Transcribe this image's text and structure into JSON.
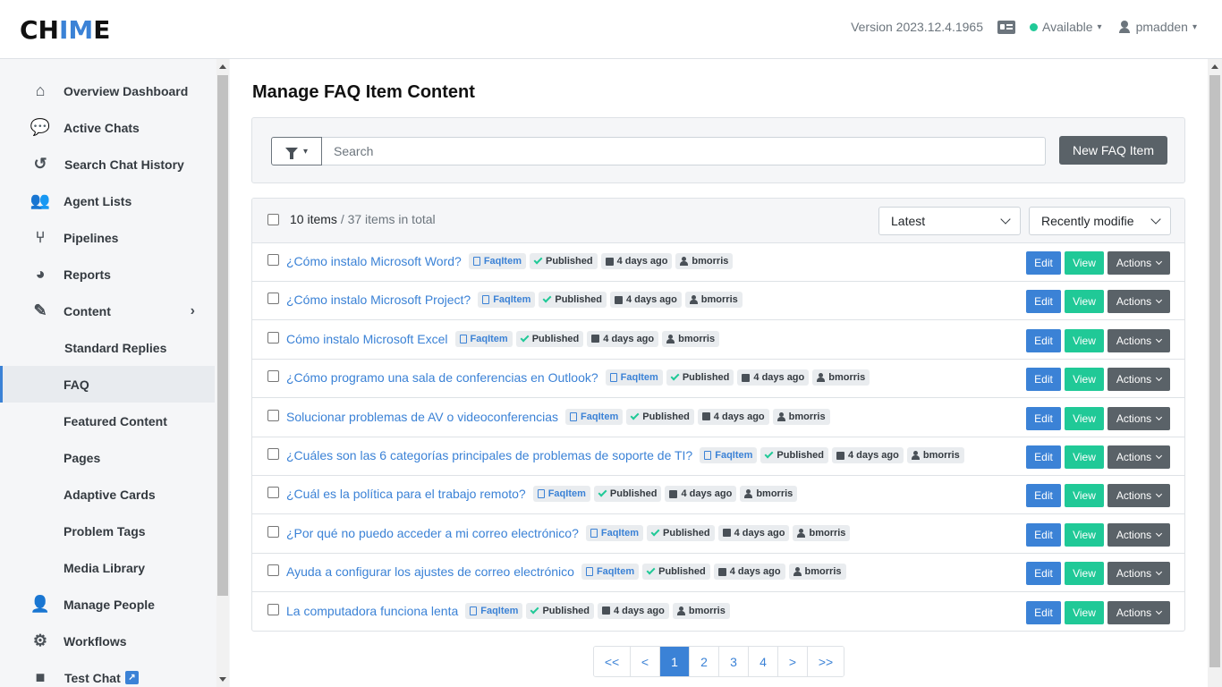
{
  "header": {
    "logo_pre": "CH",
    "logo_accent": "IM",
    "logo_post": "E",
    "version": "Version 2023.12.4.1965",
    "status": "Available",
    "username": "pmadden"
  },
  "sidebar": {
    "items": [
      {
        "label": "Overview Dashboard",
        "icon": "home-icon"
      },
      {
        "label": "Active Chats",
        "icon": "chats-icon"
      },
      {
        "label": "Search Chat History",
        "icon": "history-icon"
      },
      {
        "label": "Agent Lists",
        "icon": "users-icon"
      },
      {
        "label": "Pipelines",
        "icon": "pipeline-icon"
      },
      {
        "label": "Reports",
        "icon": "pie-chart-icon"
      },
      {
        "label": "Content",
        "icon": "edit-icon"
      },
      {
        "label": "Standard Replies"
      },
      {
        "label": "FAQ"
      },
      {
        "label": "Featured Content"
      },
      {
        "label": "Pages"
      },
      {
        "label": "Adaptive Cards"
      },
      {
        "label": "Problem Tags"
      },
      {
        "label": "Media Library"
      },
      {
        "label": "Manage People",
        "icon": "person-icon"
      },
      {
        "label": "Workflows",
        "icon": "workflow-icon"
      },
      {
        "label": "Test Chat",
        "icon": "chat-bubble-icon"
      }
    ]
  },
  "main": {
    "title": "Manage FAQ Item Content",
    "search_placeholder": "Search",
    "new_button": "New FAQ Item",
    "count_label": "10 items",
    "total_label": "/ 37 items in total",
    "sort_latest": "Latest",
    "sort_field": "Recently modifie",
    "tag_type": "FaqItem",
    "tag_status": "Published",
    "tag_date": "4 days ago",
    "tag_user": "bmorris",
    "btn_edit": "Edit",
    "btn_view": "View",
    "btn_actions": "Actions",
    "rows": [
      "¿Cómo instalo Microsoft Word?",
      "¿Cómo instalo Microsoft Project?",
      "Cómo instalo Microsoft Excel",
      "¿Cómo programo una sala de conferencias en Outlook?",
      "Solucionar problemas de AV o videoconferencias",
      "¿Cuáles son las 6 categorías principales de problemas de soporte de TI?",
      "¿Cuál es la política para el trabajo remoto?",
      "¿Por qué no puedo acceder a mi correo electrónico?",
      "Ayuda a configurar los ajustes de correo electrónico",
      "La computadora funciona lenta"
    ],
    "pagination": [
      "<<",
      "<",
      "1",
      "2",
      "3",
      "4",
      ">",
      ">>"
    ],
    "active_page": "1"
  },
  "colors": {
    "accent": "#3b82d6",
    "success": "#20c997",
    "secondary": "#5a6268"
  }
}
